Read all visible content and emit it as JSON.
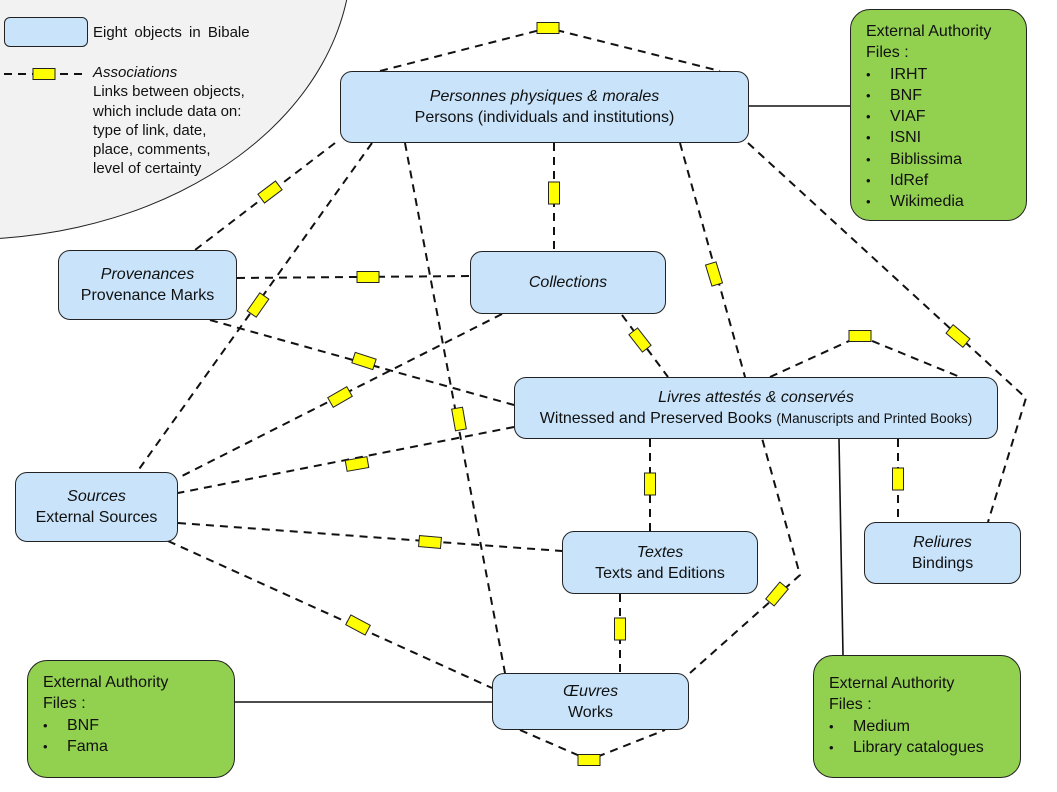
{
  "legend": {
    "object_label": "Eight objects in Bibale",
    "association_title": "Associations",
    "association_lines": [
      "Links between objects,",
      "which include data on:",
      "type of link, date,",
      "place, comments,",
      "level of certainty"
    ]
  },
  "nodes": {
    "persons": {
      "fr": "Personnes physiques & morales",
      "en": "Persons (individuals and institutions)"
    },
    "provenances": {
      "fr": "Provenances",
      "en": "Provenance Marks"
    },
    "collections": {
      "fr": "Collections",
      "en": ""
    },
    "books": {
      "fr": "Livres attestés & conservés",
      "en": "Witnessed and Preserved Books",
      "note": "(Manuscripts and Printed Books)"
    },
    "sources": {
      "fr": "Sources",
      "en": "External Sources"
    },
    "textes": {
      "fr": "Textes",
      "en": "Texts and Editions"
    },
    "reliures": {
      "fr": "Reliures",
      "en": "Bindings"
    },
    "oeuvres": {
      "fr": "Œuvres",
      "en": "Works"
    }
  },
  "external_files": {
    "persons": {
      "title_lines": [
        "External Authority",
        "Files :"
      ],
      "items": [
        "IRHT",
        "BNF",
        "VIAF",
        "ISNI",
        "Biblissima",
        "IdRef",
        "Wikimedia"
      ]
    },
    "oeuvres": {
      "title_lines": [
        "External Authority",
        "Files :"
      ],
      "items": [
        "BNF",
        "Fama"
      ]
    },
    "books": {
      "title_lines": [
        "External Authority",
        "Files :"
      ],
      "items": [
        "Medium",
        "Library catalogues"
      ]
    }
  },
  "associations": [
    [
      "persons",
      "persons",
      "self-loop top"
    ],
    [
      "persons",
      "provenances"
    ],
    [
      "persons",
      "sources"
    ],
    [
      "persons",
      "oeuvres"
    ],
    [
      "persons",
      "collections"
    ],
    [
      "persons",
      "textes"
    ],
    [
      "persons",
      "reliures"
    ],
    [
      "provenances",
      "collections"
    ],
    [
      "provenances",
      "books"
    ],
    [
      "collections",
      "books"
    ],
    [
      "collections",
      "sources"
    ],
    [
      "books",
      "books",
      "self-loop top"
    ],
    [
      "books",
      "sources"
    ],
    [
      "books",
      "textes"
    ],
    [
      "books",
      "reliures"
    ],
    [
      "sources",
      "textes"
    ],
    [
      "sources",
      "oeuvres"
    ],
    [
      "textes",
      "oeuvres"
    ],
    [
      "oeuvres",
      "oeuvres",
      "self-loop bottom"
    ]
  ],
  "colors": {
    "object_fill": "#c9e4fa",
    "external_fill": "#92d050",
    "association_marker": "#ffff00",
    "legend_bg": "#f2f2f2"
  }
}
